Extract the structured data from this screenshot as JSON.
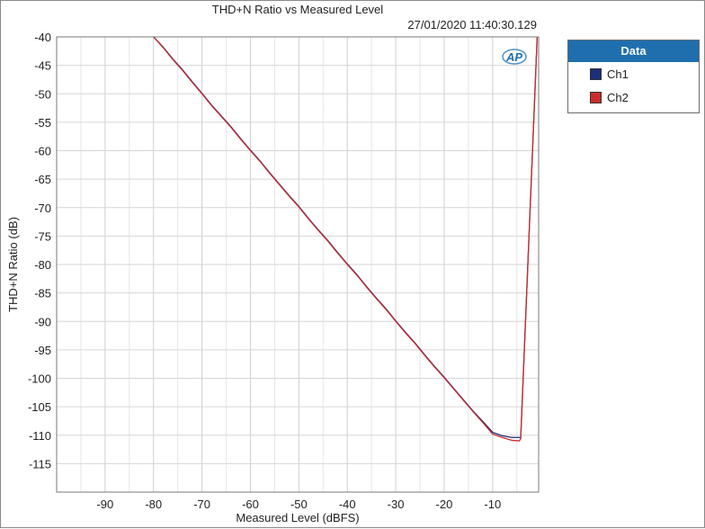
{
  "header": {
    "title": "THD+N Ratio vs Measured Level",
    "timestamp": "27/01/2020 11:40:30.129"
  },
  "legend": {
    "title": "Data",
    "items": [
      {
        "label": "Ch1",
        "color": "#1b2f7a"
      },
      {
        "label": "Ch2",
        "color": "#cc2b2b"
      }
    ]
  },
  "logo": {
    "text": "AP",
    "icon": "ap-logo-icon"
  },
  "chart_data": {
    "type": "line",
    "title": "THD+N Ratio vs Measured Level",
    "xlabel": "Measured Level (dBFS)",
    "ylabel": "THD+N Ratio (dB)",
    "xlim": [
      -100,
      -0.5
    ],
    "ylim": [
      -120,
      -40
    ],
    "xticks": [
      -90,
      -80,
      -70,
      -60,
      -50,
      -40,
      -30,
      -20,
      -10
    ],
    "yticks": [
      -40,
      -45,
      -50,
      -55,
      -60,
      -65,
      -70,
      -75,
      -80,
      -85,
      -90,
      -95,
      -100,
      -105,
      -110,
      -115
    ],
    "grid": true,
    "legend_position": "right",
    "series": [
      {
        "name": "Ch1",
        "color": "#1b2f7a",
        "points": [
          [
            -80,
            -40.0
          ],
          [
            -78,
            -41.8
          ],
          [
            -76,
            -43.9
          ],
          [
            -74,
            -45.8
          ],
          [
            -72,
            -47.9
          ],
          [
            -70,
            -49.9
          ],
          [
            -68,
            -52.0
          ],
          [
            -66,
            -53.9
          ],
          [
            -64,
            -55.8
          ],
          [
            -62,
            -57.9
          ],
          [
            -60,
            -59.9
          ],
          [
            -58,
            -61.8
          ],
          [
            -56,
            -63.9
          ],
          [
            -54,
            -65.9
          ],
          [
            -52,
            -67.9
          ],
          [
            -50,
            -69.8
          ],
          [
            -48,
            -71.9
          ],
          [
            -46,
            -73.9
          ],
          [
            -44,
            -75.8
          ],
          [
            -42,
            -77.9
          ],
          [
            -40,
            -79.9
          ],
          [
            -38,
            -81.8
          ],
          [
            -36,
            -83.9
          ],
          [
            -34,
            -85.9
          ],
          [
            -32,
            -87.8
          ],
          [
            -30,
            -89.9
          ],
          [
            -28,
            -91.9
          ],
          [
            -26,
            -93.8
          ],
          [
            -24,
            -95.9
          ],
          [
            -22,
            -97.9
          ],
          [
            -20,
            -99.8
          ],
          [
            -18,
            -101.8
          ],
          [
            -16,
            -103.8
          ],
          [
            -14,
            -105.8
          ],
          [
            -12,
            -107.6
          ],
          [
            -10,
            -109.5
          ],
          [
            -8,
            -110.1
          ],
          [
            -6,
            -110.4
          ],
          [
            -4.2,
            -110.4
          ],
          [
            -0.8,
            -40.0
          ]
        ]
      },
      {
        "name": "Ch2",
        "color": "#cc2b2b",
        "points": [
          [
            -80,
            -40.0
          ],
          [
            -78,
            -41.9
          ],
          [
            -76,
            -44.0
          ],
          [
            -74,
            -45.9
          ],
          [
            -72,
            -48.0
          ],
          [
            -70,
            -50.0
          ],
          [
            -68,
            -52.1
          ],
          [
            -66,
            -54.0
          ],
          [
            -64,
            -55.9
          ],
          [
            -62,
            -58.0
          ],
          [
            -60,
            -60.0
          ],
          [
            -58,
            -61.9
          ],
          [
            -56,
            -64.0
          ],
          [
            -54,
            -66.0
          ],
          [
            -52,
            -68.0
          ],
          [
            -50,
            -69.9
          ],
          [
            -48,
            -72.0
          ],
          [
            -46,
            -74.0
          ],
          [
            -44,
            -75.9
          ],
          [
            -42,
            -78.0
          ],
          [
            -40,
            -80.0
          ],
          [
            -38,
            -81.9
          ],
          [
            -36,
            -84.0
          ],
          [
            -34,
            -86.0
          ],
          [
            -32,
            -87.9
          ],
          [
            -30,
            -90.0
          ],
          [
            -28,
            -92.0
          ],
          [
            -26,
            -93.9
          ],
          [
            -24,
            -96.0
          ],
          [
            -22,
            -98.0
          ],
          [
            -20,
            -99.9
          ],
          [
            -18,
            -101.9
          ],
          [
            -16,
            -103.9
          ],
          [
            -14,
            -105.9
          ],
          [
            -12,
            -107.8
          ],
          [
            -10,
            -109.8
          ],
          [
            -8,
            -110.4
          ],
          [
            -6,
            -110.9
          ],
          [
            -4.5,
            -111.0
          ],
          [
            -4.2,
            -110.6
          ],
          [
            -0.8,
            -40.0
          ]
        ]
      }
    ]
  }
}
